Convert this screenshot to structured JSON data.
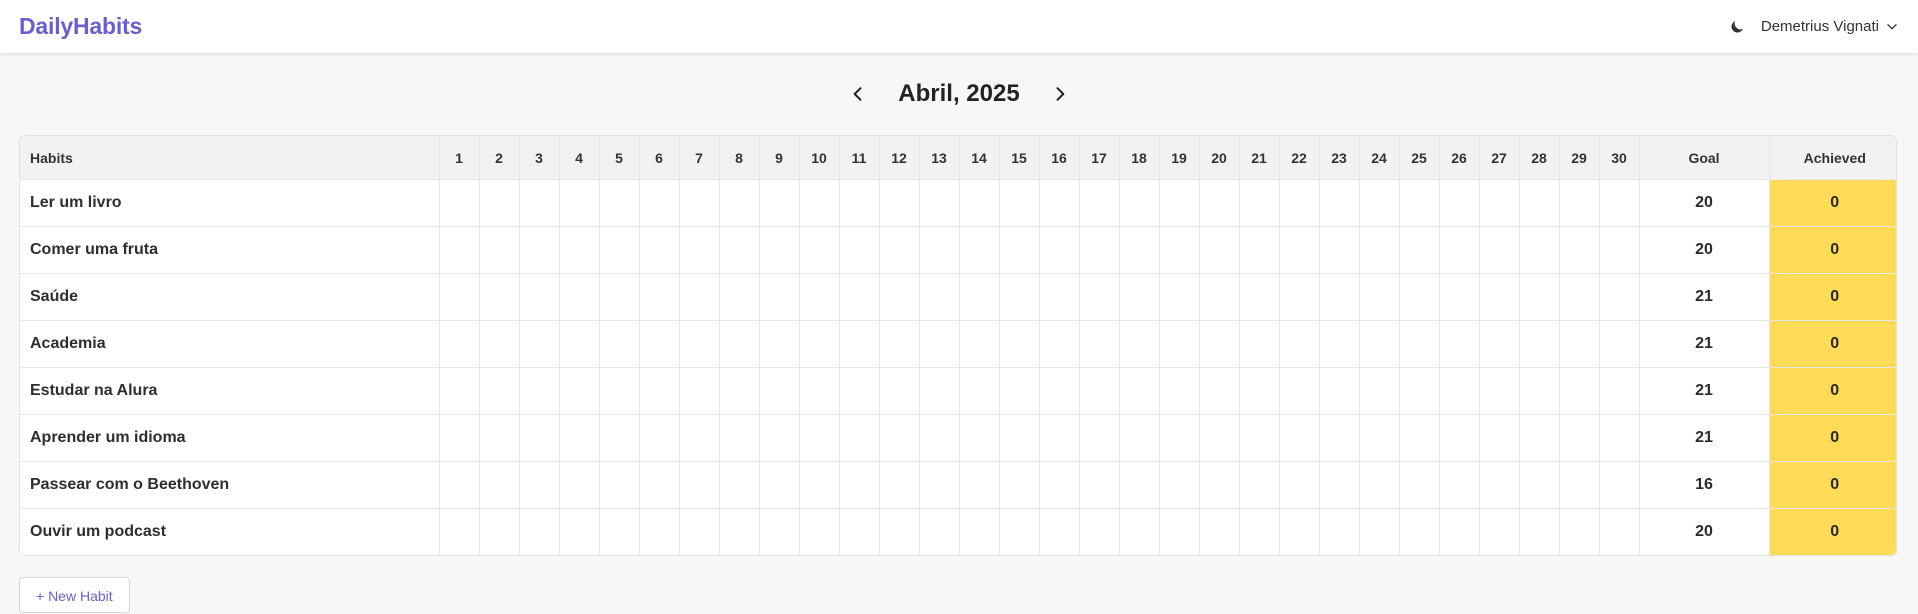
{
  "app": {
    "brand": "DailyHabits",
    "user_name": "Demetrius Vignati",
    "theme_icon": "moon-icon"
  },
  "calendar": {
    "title": "Abril, 2025",
    "prev_icon": "chevron-left-icon",
    "next_icon": "chevron-right-icon"
  },
  "table": {
    "habit_header": "Habits",
    "days": [
      "1",
      "2",
      "3",
      "4",
      "5",
      "6",
      "7",
      "8",
      "9",
      "10",
      "11",
      "12",
      "13",
      "14",
      "15",
      "16",
      "17",
      "18",
      "19",
      "20",
      "21",
      "22",
      "23",
      "24",
      "25",
      "26",
      "27",
      "28",
      "29",
      "30"
    ],
    "goal_header": "Goal",
    "achieved_header": "Achieved",
    "achieved_color": "#ffdb58",
    "rows": [
      {
        "habit": "Ler um livro",
        "goal": "20",
        "achieved": "0"
      },
      {
        "habit": "Comer uma fruta",
        "goal": "20",
        "achieved": "0"
      },
      {
        "habit": "Saúde",
        "goal": "21",
        "achieved": "0"
      },
      {
        "habit": "Academia",
        "goal": "21",
        "achieved": "0"
      },
      {
        "habit": "Estudar na Alura",
        "goal": "21",
        "achieved": "0"
      },
      {
        "habit": "Aprender um idioma",
        "goal": "21",
        "achieved": "0"
      },
      {
        "habit": "Passear com o Beethoven",
        "goal": "16",
        "achieved": "0"
      },
      {
        "habit": "Ouvir um podcast",
        "goal": "20",
        "achieved": "0"
      }
    ]
  },
  "actions": {
    "new_habit": "+ New Habit"
  },
  "colors": {
    "brand": "#6a5fd0",
    "background": "#f7f7f7"
  }
}
